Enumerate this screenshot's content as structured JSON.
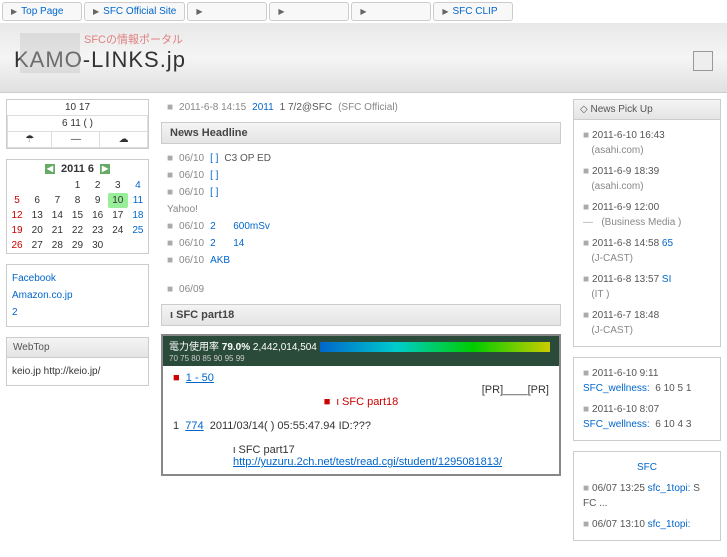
{
  "topnav": {
    "items": [
      "Top Page",
      "SFC Official Site",
      "",
      "",
      "",
      "SFC CLIP"
    ]
  },
  "header": {
    "sub": "SFCの情報ポータル",
    "title": "KAMO-LINKS.jp"
  },
  "weather": {
    "temp": "10 17",
    "date": "6 11 ( )",
    "iconL": "☂",
    "dash": "—",
    "iconR": "☁"
  },
  "calendar": {
    "label": "2011  6",
    "daynames": [
      "",
      "",
      "",
      "1",
      "2",
      "3",
      "4"
    ],
    "rows": [
      [
        "5",
        "6",
        "7",
        "8",
        "9",
        "10",
        "11"
      ],
      [
        "12",
        "13",
        "14",
        "15",
        "16",
        "17",
        "18"
      ],
      [
        "19",
        "20",
        "21",
        "22",
        "23",
        "24",
        "25"
      ],
      [
        "26",
        "27",
        "28",
        "29",
        "30",
        "",
        ""
      ]
    ]
  },
  "leftlinks": {
    "hd1": "",
    "items1": [
      "Facebook",
      "Amazon.co.jp",
      "2"
    ],
    "hd2": "WebTop",
    "items2": [
      "keio.jp http://keio.jp/"
    ]
  },
  "mainTop": {
    "date": "2011-6-8 14:15",
    "link": "2011",
    "tail1": "1  7/2@SFC",
    "tail2": "(SFC Official)"
  },
  "news": {
    "hd": "News Headline",
    "rows": [
      {
        "date": "06/10",
        "pre": "[   ]",
        "text": "        C3   OP     ED"
      },
      {
        "date": "06/10",
        "pre": "[   ]",
        "text": ""
      },
      {
        "date": "06/10",
        "pre": "[   ]",
        "text": ""
      }
    ],
    "yahoo": "Yahoo!",
    "yrows": [
      {
        "date": "06/10",
        "links": [
          "2",
          "600mSv"
        ]
      },
      {
        "date": "06/10",
        "links": [
          "2",
          "14"
        ]
      },
      {
        "date": "06/10",
        "links": [
          "AKB"
        ]
      }
    ],
    "last": "06/09"
  },
  "forum": {
    "tab": "ι         SFC  part18",
    "powerLabel": "電力使用率",
    "powerPct": "79.0%",
    "powerNum": "2,442,014,504",
    "scale": "70     75     80     85     90     95     99",
    "link1": "1 -   50",
    "pr": "[PR]____[PR]",
    "redTitle": "ι         SFC part18",
    "line1pre": "1",
    "line1link": "774",
    "line1tail": "2011/03/14( ) 05:55:47.94 ID:???",
    "prevThread": "ι         SFC part17",
    "url": "http://yuzuru.2ch.net/test/read.cgi/student/1295081813/"
  },
  "pickup": {
    "hd": "News Pick Up",
    "items": [
      {
        "date": "2011-6-10 16:43",
        "src": "(asahi.com)",
        "link": ""
      },
      {
        "date": "2011-6-9 18:39",
        "src": "(asahi.com)",
        "link": ""
      },
      {
        "date": "2011-6-9 12:00",
        "src": "(Business Media )",
        "link": ""
      },
      {
        "date": "2011-6-8 14:58",
        "src": "(J-CAST)",
        "link": "65"
      },
      {
        "date": "2011-6-8 13:57",
        "src": "(IT  )",
        "link": "SI"
      },
      {
        "date": "2011-6-7 18:48",
        "src": "(J-CAST)",
        "link": ""
      }
    ],
    "wellness": [
      {
        "date": "2011-6-10 9:11",
        "link": "SFC_wellness:",
        "tail": "6 10   5 1"
      },
      {
        "date": "2011-6-10 8:07",
        "link": "SFC_wellness:",
        "tail": "6 10   4   3"
      }
    ],
    "sfc": {
      "hd": "SFC",
      "rows": [
        {
          "date": "06/07 13:25",
          "link": "sfc_1topi:",
          "tail": "S FC ..."
        },
        {
          "date": "06/07 13:10",
          "link": "sfc_1topi:",
          "tail": ""
        }
      ]
    }
  }
}
